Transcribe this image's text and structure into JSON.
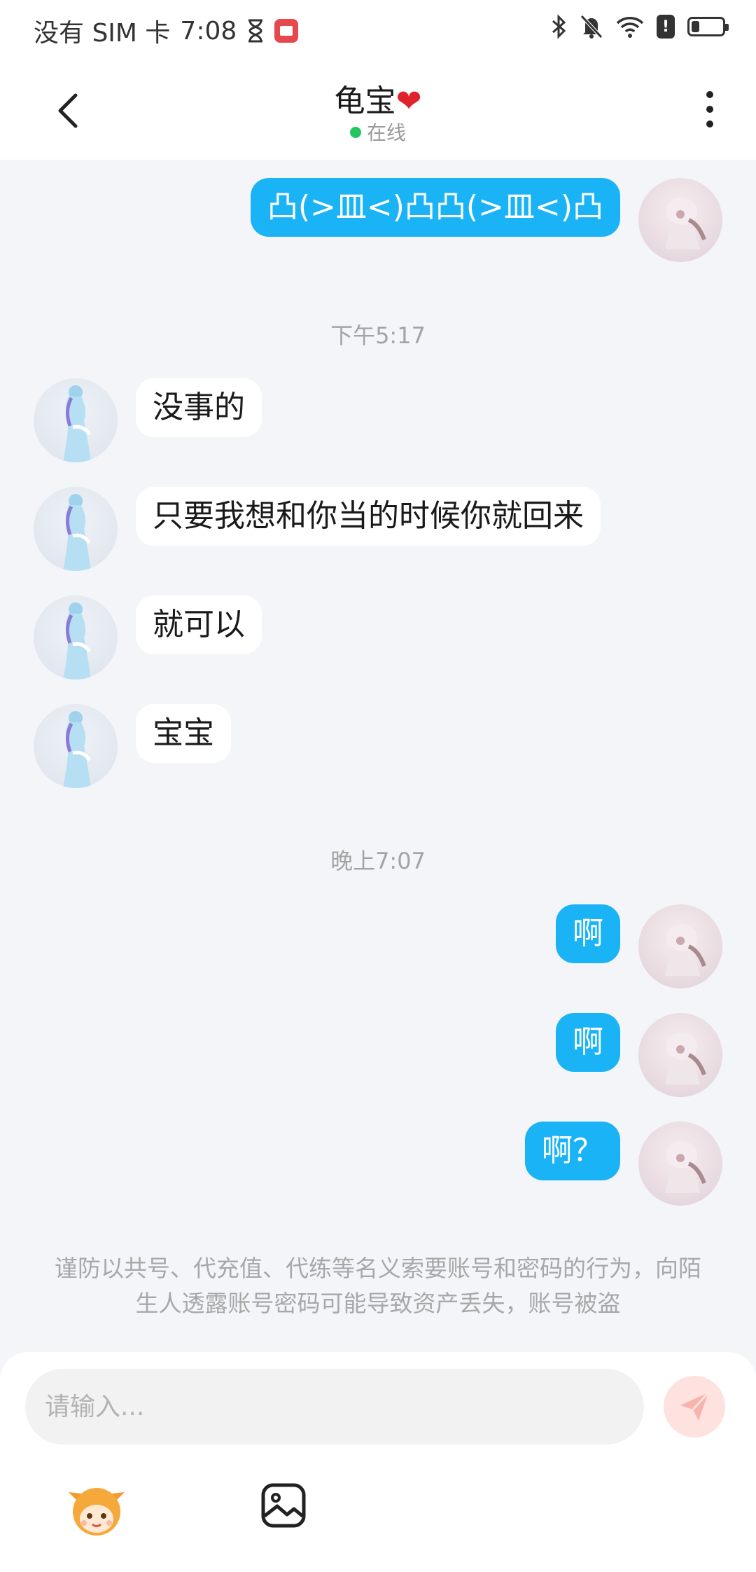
{
  "status_bar": {
    "carrier": "没有 SIM 卡",
    "time": "7:08",
    "icons": [
      "hourglass-icon",
      "red-app-icon",
      "bluetooth-icon",
      "bell-off-icon",
      "wifi-icon",
      "warning-icon",
      "battery-icon"
    ],
    "battery_level": 0.25
  },
  "header": {
    "title": "龟宝",
    "title_emoji": "❤",
    "status": "在线",
    "status_color": "#22c55e"
  },
  "messages": {
    "m0": "凸(>皿<)凸凸(>皿<)凸",
    "time1": "下午5:17",
    "m1": "没事的",
    "m2": "只要我想和你当的时候你就回来",
    "m3": "就可以",
    "m4": "宝宝",
    "time2": "晚上7:07",
    "m5": "啊",
    "m6": "啊",
    "m7": "啊？"
  },
  "notice": "谨防以共号、代充值、代练等名义索要账号和密码的行为，向陌生人透露账号密码可能导致资产丢失，账号被盗",
  "composer": {
    "placeholder": "请输入...",
    "value": ""
  },
  "colors": {
    "my_bubble": "#1ab3f5",
    "other_bubble": "#ffffff",
    "background": "#f3f5f8",
    "send_button": "#fde2df"
  }
}
